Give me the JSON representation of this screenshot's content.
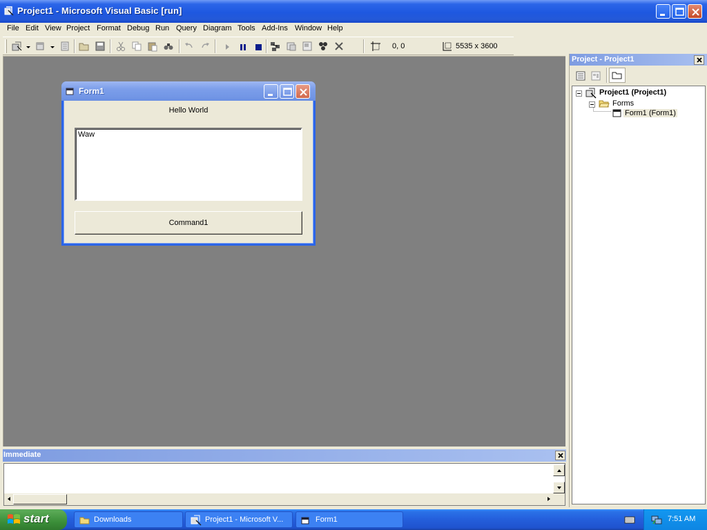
{
  "window": {
    "title": "Project1 - Microsoft Visual Basic [run]"
  },
  "menu": [
    "File",
    "Edit",
    "View",
    "Project",
    "Format",
    "Debug",
    "Run",
    "Query",
    "Diagram",
    "Tools",
    "Add-Ins",
    "Window",
    "Help"
  ],
  "toolbar": {
    "position": "0, 0",
    "size": "5535 x 3600"
  },
  "form1": {
    "title": "Form1",
    "label": "Hello World",
    "textbox_value": "Waw",
    "command_label": "Command1"
  },
  "immediate": {
    "title": "Immediate"
  },
  "project_explorer": {
    "title": "Project - Project1",
    "root": "Project1 (Project1)",
    "folder": "Forms",
    "item": "Form1 (Form1)"
  },
  "taskbar": {
    "start_label": "start",
    "tasks": [
      "Downloads",
      "Project1 - Microsoft V...",
      "Form1"
    ],
    "clock": "7:51 AM"
  },
  "colors": {
    "title_blue": "#2B65E8",
    "mdi_gray": "#808080",
    "form_title": "#7C9EEA",
    "start_green": "#3C8F3A"
  }
}
